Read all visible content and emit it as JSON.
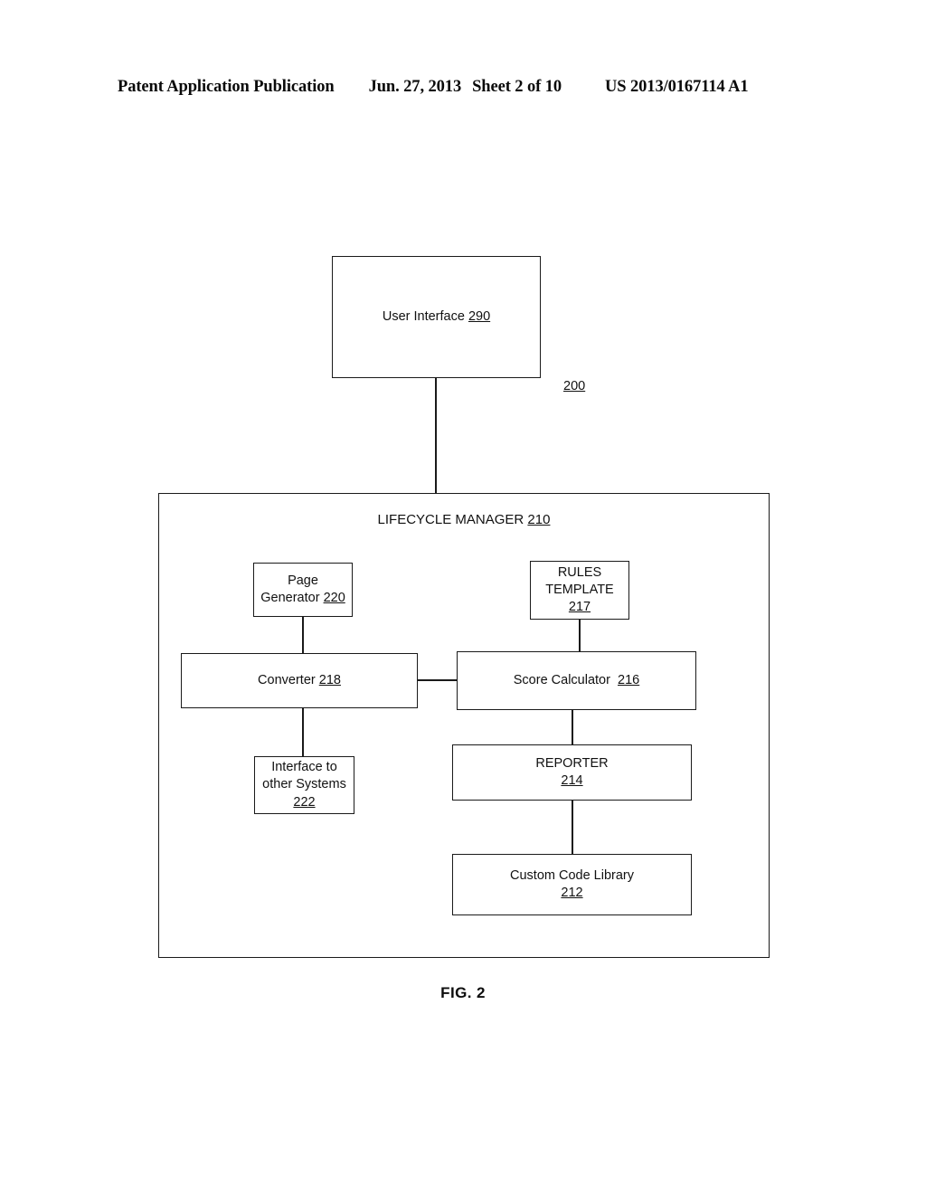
{
  "header": {
    "publication": "Patent Application Publication",
    "date": "Jun. 27, 2013",
    "sheet": "Sheet 2 of 10",
    "number": "US 2013/0167114 A1"
  },
  "figure": {
    "caption": "FIG. 2",
    "system_reference": "200"
  },
  "diagram": {
    "user_interface": {
      "title": "User Interface",
      "ref": "290",
      "full": "User Interface 290"
    },
    "lifecycle_manager": {
      "title": "LIFECYCLE MANAGER",
      "ref": "210",
      "full": "LIFECYCLE MANAGER 210"
    },
    "page_generator": {
      "title": "Page\nGenerator",
      "ref": "220",
      "full": "Page\nGenerator 220"
    },
    "rules_template": {
      "title": "RULES\nTEMPLATE",
      "ref": "217",
      "full": "RULES\nTEMPLATE\n217"
    },
    "converter": {
      "title": "Converter",
      "ref": "218",
      "full": "Converter 218"
    },
    "score_calculator": {
      "title": "Score Calculator",
      "ref": "216",
      "full": "Score Calculator  216"
    },
    "interface_other_systems": {
      "title": "Interface to\nother Systems",
      "ref": "222",
      "full": "Interface to\nother Systems\n222"
    },
    "reporter": {
      "title": "REPORTER",
      "ref": "214",
      "full": "REPORTER\n214"
    },
    "custom_code_library": {
      "title": "Custom Code Library",
      "ref": "212",
      "full": "Custom Code Library\n212"
    }
  },
  "colors": {
    "ink": "#111111",
    "paper": "#ffffff"
  }
}
